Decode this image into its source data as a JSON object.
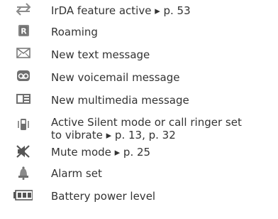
{
  "rows": [
    {
      "icon": "irda-arrows-icon",
      "text": "IrDA feature active ▸ p. 53"
    },
    {
      "icon": "roaming-r-icon",
      "text": "Roaming"
    },
    {
      "icon": "envelope-icon",
      "text": "New text message"
    },
    {
      "icon": "voicemail-icon",
      "text": "New voicemail message"
    },
    {
      "icon": "multimedia-message-icon",
      "text": "New multimedia message"
    },
    {
      "icon": "vibrate-phone-icon",
      "text": "Active Silent mode or call ringer set",
      "text2": "to vibrate ▸ p. 13, p. 32"
    },
    {
      "icon": "mute-speaker-icon",
      "text": "Mute mode ▸ p. 25"
    },
    {
      "icon": "alarm-bell-icon",
      "text": "Alarm set"
    },
    {
      "icon": "battery-icon",
      "text": "Battery power level"
    }
  ],
  "colors": {
    "text": "#333333",
    "icon": "#7a7a7a",
    "icon_dark": "#555555"
  }
}
